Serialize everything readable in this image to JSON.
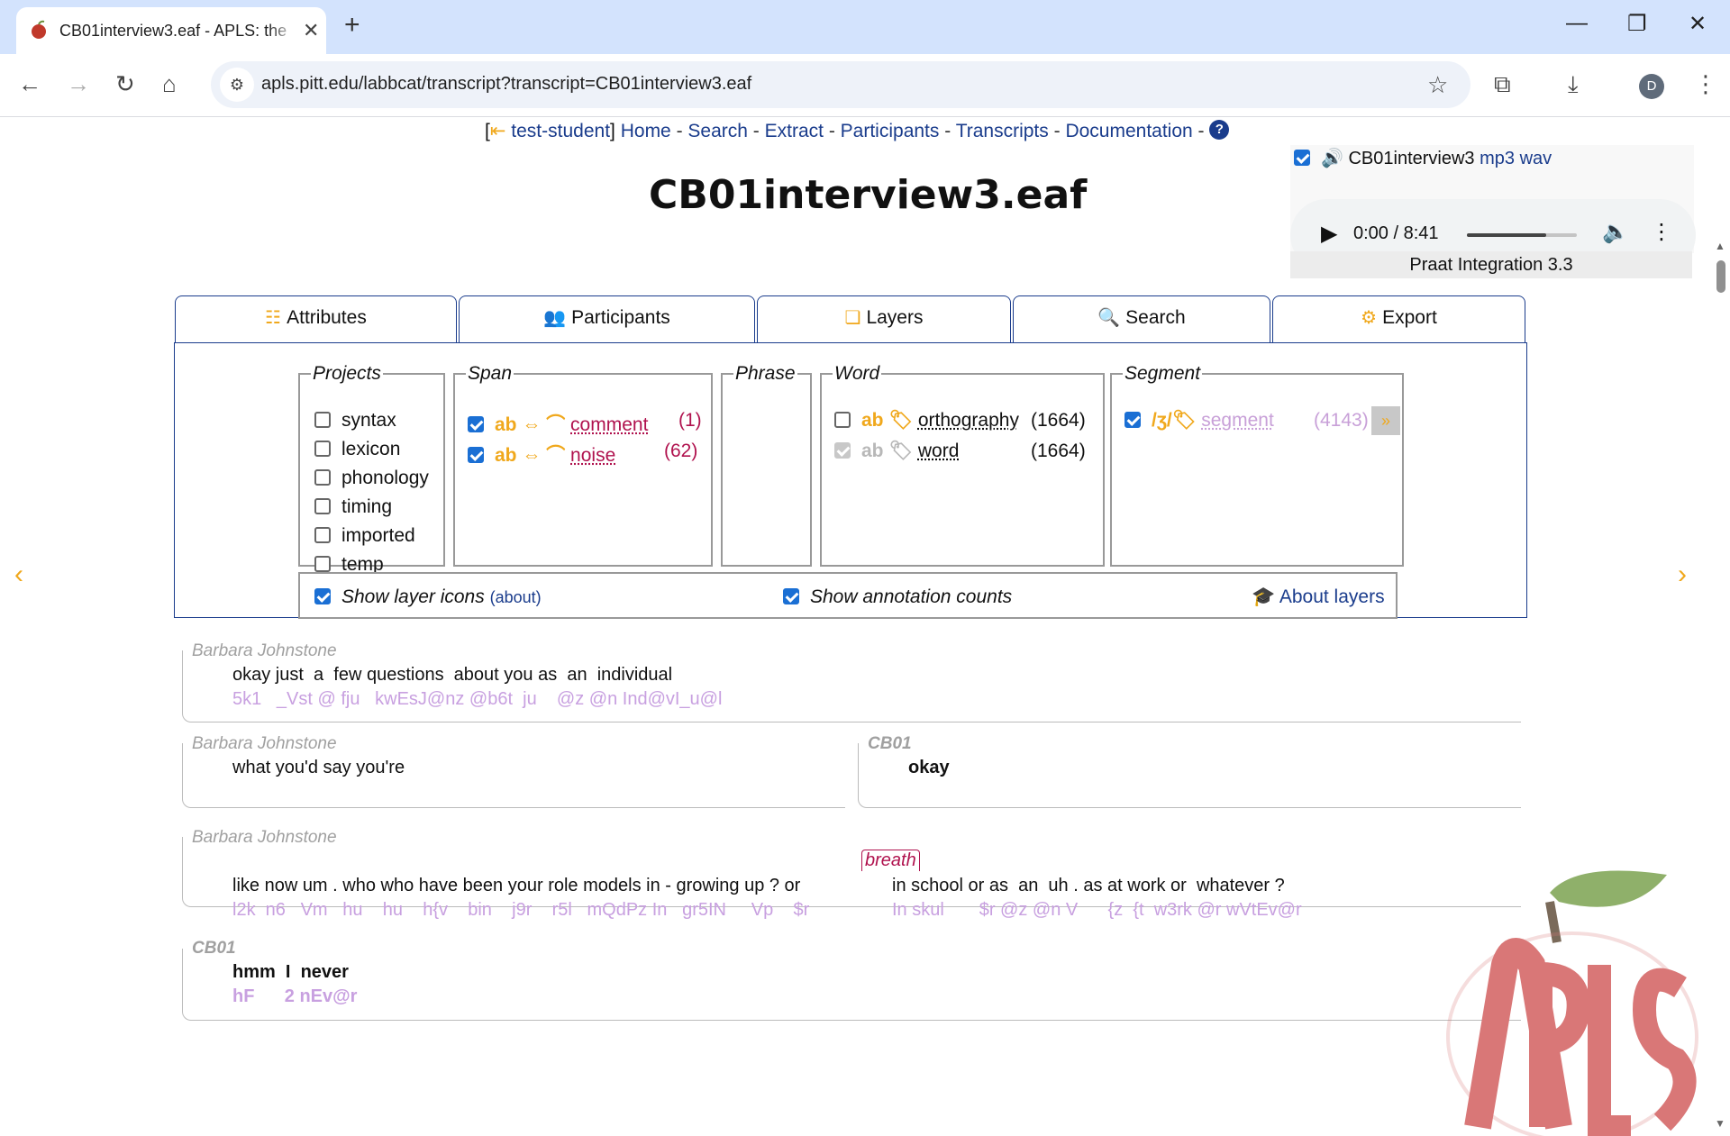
{
  "browser": {
    "tab_title": "CB01interview3.eaf - APLS: the",
    "tab_close": "✕",
    "new_tab": "+",
    "url": "apls.pitt.edu/labbcat/transcript?transcript=CB01interview3.eaf",
    "profile_initial": "D",
    "win_min": "—",
    "win_restore": "❐",
    "win_close": "✕"
  },
  "nav": {
    "open_bracket": "[",
    "user": "test-student",
    "close_bracket": "]",
    "items": [
      "Home",
      "Search",
      "Extract",
      "Participants",
      "Transcripts",
      "Documentation"
    ],
    "sep": " - ",
    "help": "?"
  },
  "title": "CB01interview3.eaf",
  "audio": {
    "name": "CB01interview3",
    "mp3": "mp3",
    "wav": "wav",
    "time": "0:00 / 8:41",
    "progress_fraction": 0.72,
    "praat": "Praat Integration 3.3"
  },
  "tabs": [
    "Attributes",
    "Participants",
    "Layers",
    "Search",
    "Export"
  ],
  "layers": {
    "projects_legend": "Projects",
    "projects": [
      "syntax",
      "lexicon",
      "phonology",
      "timing",
      "imported",
      "temp"
    ],
    "span_legend": "Span",
    "span": [
      {
        "icon": "ab",
        "name": "comment",
        "count": "(1)"
      },
      {
        "icon": "ab",
        "name": "noise",
        "count": "(62)"
      }
    ],
    "phrase_legend": "Phrase",
    "word_legend": "Word",
    "word": [
      {
        "icon": "ab",
        "name": "orthography",
        "count": "(1664)"
      },
      {
        "icon": "ab",
        "name": "word",
        "count": "(1664)"
      }
    ],
    "segment_legend": "Segment",
    "segment": {
      "icon": "/ʒ/",
      "name": "segment",
      "count": "(4143)"
    },
    "show_icons": "Show layer icons",
    "about_small": "(about)",
    "show_counts": "Show annotation counts",
    "about_layers": "About layers"
  },
  "transcript": {
    "turns": [
      {
        "speaker": "Barbara Johnstone",
        "words": "okay just  a  few questions  about you as  an  individual",
        "phon": "5k1   _Vst @ fju   kwEsJ@nz @b6t  ju    @z @n Ind@vI_u@l"
      },
      {
        "speaker": "Barbara Johnstone",
        "words": "what you'd say you're",
        "phon": ""
      },
      {
        "speaker": "CB01",
        "words": "okay",
        "phon": ""
      },
      {
        "speaker": "Barbara Johnstone",
        "words": "like now um . who who have been your role models in - growing up ? or",
        "phon": "l2k  n6   Vm   hu    hu    h{v    bin    j9r    r5l   mQdPz In   gr5IN     Vp    $r",
        "words2": "in school or as  an  uh . as at work or  whatever ?",
        "phon2": "In skul       $r @z @n V      {z  {t  w3rk @r wVtEv@r",
        "breath": "breath"
      },
      {
        "speaker": "CB01",
        "words": "hmm  I  never",
        "phon": "hF      2 nEv@r"
      }
    ]
  },
  "colors": {
    "accent": "#1a3c8c",
    "orange": "#f0a81c",
    "magenta": "#b0124e",
    "phonetic": "#c8a0e0"
  }
}
